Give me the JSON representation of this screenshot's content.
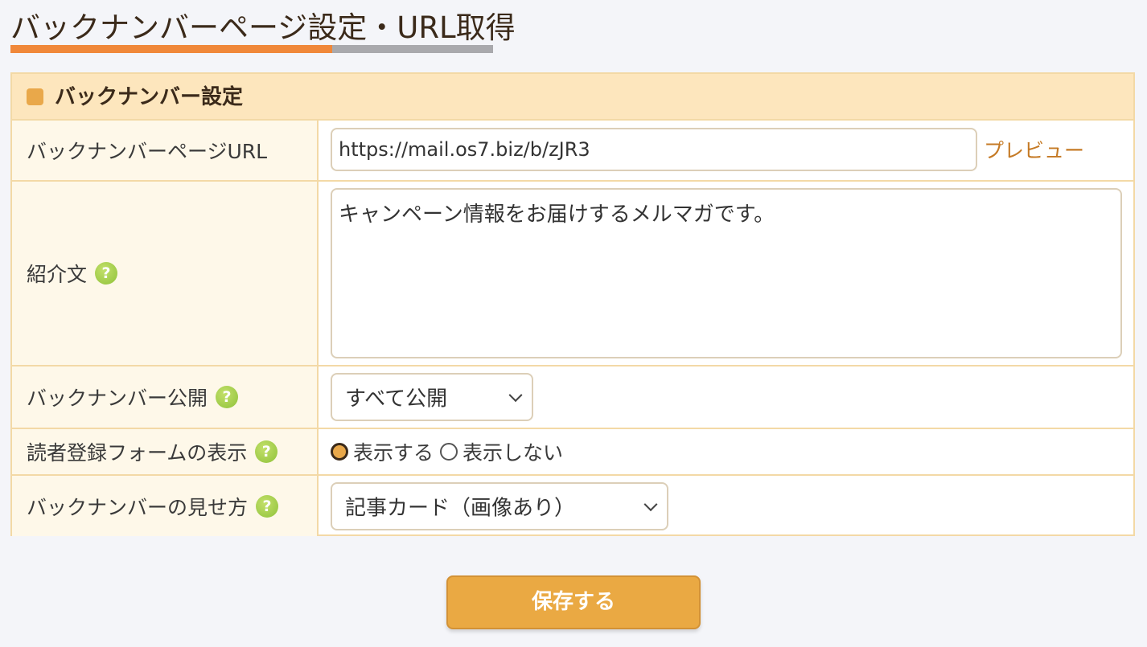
{
  "page": {
    "title": "バックナンバーページ設定・URL取得"
  },
  "panel": {
    "header": "バックナンバー設定"
  },
  "fields": {
    "url": {
      "label": "バックナンバーページURL",
      "value": "https://mail.os7.biz/b/zJR3",
      "preview_link": "プレビュー"
    },
    "intro": {
      "label": "紹介文",
      "value": "キャンペーン情報をお届けするメルマガです。"
    },
    "publish": {
      "label": "バックナンバー公開",
      "selected": "すべて公開"
    },
    "reader_form": {
      "label": "読者登録フォームの表示",
      "options": [
        "表示する",
        "表示しない"
      ],
      "selected_index": 0
    },
    "display_style": {
      "label": "バックナンバーの見せ方",
      "selected": "記事カード（画像あり）"
    }
  },
  "help_icon_text": "?",
  "save_button": "保存する",
  "colors": {
    "accent_orange": "#f0883a",
    "button": "#eaa943",
    "border": "#f3d9a6",
    "header_bg": "#fde6bd",
    "link": "#c57a25"
  }
}
